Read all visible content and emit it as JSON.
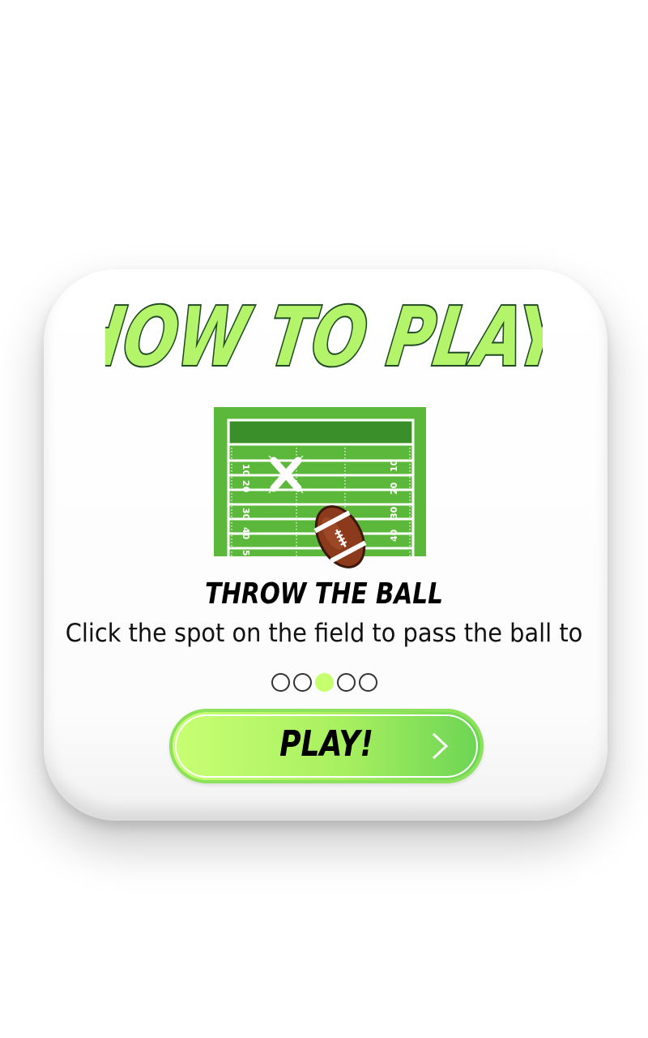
{
  "dialog": {
    "title": "HOW TO PLAY",
    "step_title": "THROW THE BALL",
    "step_description": "Click the spot on the field to pass the ball to",
    "pagination": {
      "total": 5,
      "active_index": 2
    },
    "play_button_label": "PLAY!",
    "field_yard_numbers": [
      "10",
      "20",
      "30",
      "40",
      "5"
    ],
    "colors": {
      "title_fill": "#b4f46a",
      "title_outline": "#1f4a24",
      "field_green": "#5bb83a",
      "field_dark_green": "#3b8f2b",
      "accent_green": "#c6ff6e",
      "ball_brown": "#8b3a1c"
    },
    "icons": {
      "target_marker": "x-mark-icon",
      "ball": "football-icon",
      "next": "chevron-right-icon"
    }
  }
}
